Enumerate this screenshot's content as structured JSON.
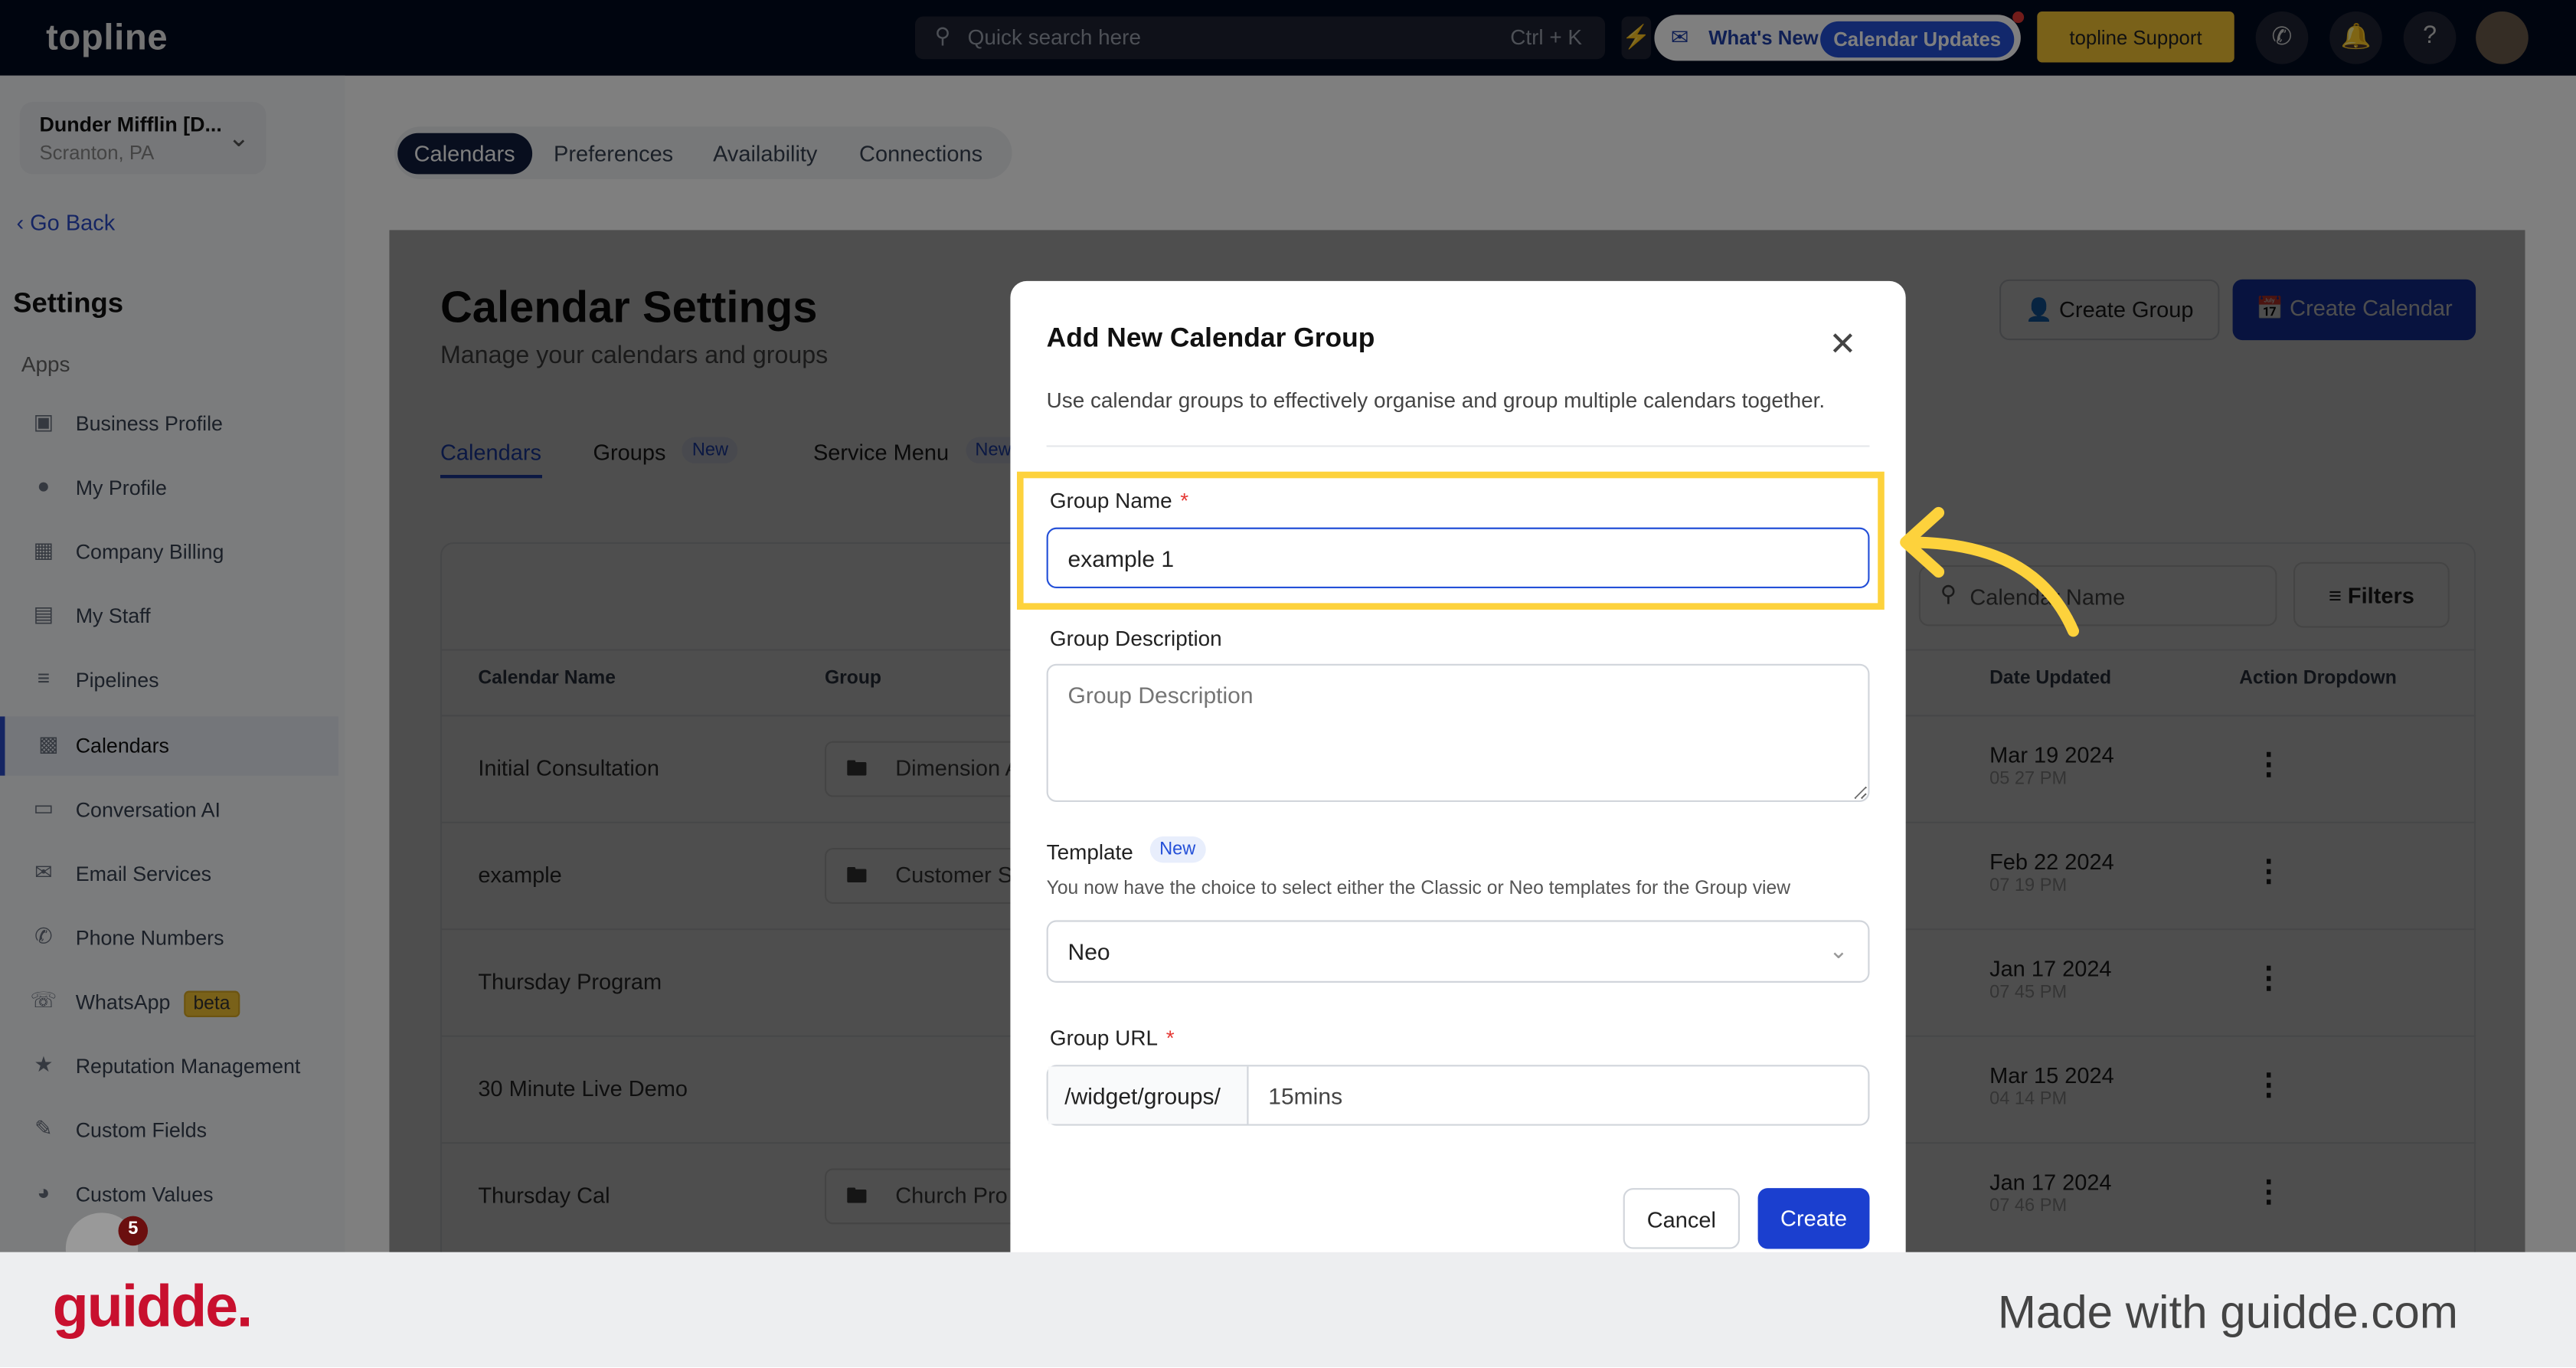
{
  "colors": {
    "accent": "#2450d8",
    "highlight": "#fdd23c",
    "topbar": "#010a1f",
    "support": "#f3c233"
  },
  "topbar": {
    "logo": "topline",
    "search_placeholder": "Quick search here",
    "search_shortcut": "Ctrl + K",
    "whats_new": "What's New",
    "calendar_updates": "Calendar Updates",
    "support": "topline Support",
    "help": "?"
  },
  "sidebar": {
    "org_name": "Dunder Mifflin [D...",
    "org_location": "Scranton, PA",
    "go_back": "Go Back",
    "settings": "Settings",
    "apps": "Apps",
    "items": [
      {
        "label": "Business Profile",
        "icon": "briefcase-icon"
      },
      {
        "label": "My Profile",
        "icon": "user-icon"
      },
      {
        "label": "Company Billing",
        "icon": "billing-icon"
      },
      {
        "label": "My Staff",
        "icon": "staff-icon"
      },
      {
        "label": "Pipelines",
        "icon": "pipeline-icon"
      },
      {
        "label": "Calendars",
        "icon": "calendar-icon",
        "active": true
      },
      {
        "label": "Conversation AI",
        "icon": "chat-icon"
      },
      {
        "label": "Email Services",
        "icon": "mail-icon"
      },
      {
        "label": "Phone Numbers",
        "icon": "phone-icon"
      },
      {
        "label": "WhatsApp",
        "icon": "whatsapp-icon",
        "badge": "beta"
      },
      {
        "label": "Reputation Management",
        "icon": "star-icon"
      },
      {
        "label": "Custom Fields",
        "icon": "edit-icon"
      },
      {
        "label": "Custom Values",
        "icon": "pie-icon"
      }
    ],
    "notification_count": "5"
  },
  "top_tabs": [
    "Calendars",
    "Preferences",
    "Availability",
    "Connections"
  ],
  "page": {
    "title": "Calendar Settings",
    "subtitle": "Manage your calendars and groups",
    "create_group": "Create Group",
    "create_calendar": "Create Calendar",
    "tabs": [
      {
        "label": "Calendars"
      },
      {
        "label": "Groups",
        "badge": "New"
      },
      {
        "label": "Service Menu",
        "badge": "New"
      }
    ],
    "search_placeholder": "Calendar Name",
    "filters": "Filters",
    "columns": [
      "Calendar Name",
      "Group",
      "Date Updated",
      "Action Dropdown"
    ],
    "rows": [
      {
        "name": "Initial Consultation",
        "group": "Dimension A",
        "date": "Mar 19 2024",
        "time": "05 27 PM"
      },
      {
        "name": "example",
        "group": "Customer S",
        "date": "Feb 22 2024",
        "time": "07 19 PM"
      },
      {
        "name": "Thursday Program",
        "group": "",
        "date": "Jan 17 2024",
        "time": "07 45 PM"
      },
      {
        "name": "30 Minute Live Demo",
        "group": "",
        "date": "Mar 15 2024",
        "time": "04 14 PM"
      },
      {
        "name": "Thursday Cal",
        "group": "Church Pro",
        "date": "Jan 17 2024",
        "time": "07 46 PM"
      }
    ]
  },
  "modal": {
    "title": "Add New Calendar Group",
    "description": "Use calendar groups to effectively organise and group multiple calendars together.",
    "group_name_label": "Group Name",
    "group_name_value": "example 1",
    "required": "*",
    "group_desc_label": "Group Description",
    "group_desc_placeholder": "Group Description",
    "template_label": "Template",
    "template_badge": "New",
    "template_help": "You now have the choice to select either the Classic or Neo templates for the Group view",
    "template_value": "Neo",
    "url_label": "Group URL",
    "url_prefix": "/widget/groups/",
    "url_value": "15mins",
    "cancel": "Cancel",
    "create": "Create"
  },
  "footer": {
    "logo": "guidde.",
    "made_with": "Made with guidde.com"
  }
}
